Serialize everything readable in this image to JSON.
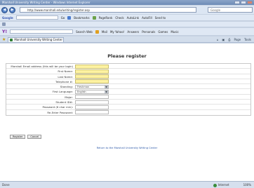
{
  "window": {
    "title": "Marshall University Writing Center - Windows Internet Explorer"
  },
  "address_bar": {
    "url": "http://www.marshall.edu/writing/register.asp",
    "search_placeholder": "Google"
  },
  "google_toolbar": {
    "label": "Google",
    "go": "Go",
    "items": [
      "Bookmarks",
      "PageRank",
      "Check",
      "AutoLink",
      "AutoFill",
      "Send to"
    ]
  },
  "yahoo_toolbar": {
    "label": "Y!",
    "search_web": "Search Web",
    "items": [
      "Mail",
      "My Yahoo!",
      "Answers",
      "Personals",
      "Games",
      "Music"
    ]
  },
  "tab": {
    "label": "Marshall University Writing Center"
  },
  "tab_tools": {
    "home": "⌂",
    "feeds": "▣",
    "print": "⎙",
    "page": "Page",
    "tools": "Tools"
  },
  "page": {
    "title": "Please register",
    "fields": [
      {
        "label": "Marshall Email address (this will be your login)",
        "kind": "input",
        "highlight": true,
        "value": ""
      },
      {
        "label": "First Name:",
        "kind": "input",
        "highlight": true,
        "value": ""
      },
      {
        "label": "Last Name:",
        "kind": "input",
        "highlight": true,
        "value": ""
      },
      {
        "label": "Telephone #:",
        "kind": "input",
        "highlight": true,
        "value": ""
      },
      {
        "label": "Standing:",
        "kind": "select",
        "value": "Freshman"
      },
      {
        "label": "First Language:",
        "kind": "select",
        "value": "English"
      },
      {
        "label": "Major:",
        "kind": "input",
        "highlight": false,
        "value": ""
      },
      {
        "label": "Student ID#:",
        "kind": "input",
        "highlight": false,
        "value": ""
      },
      {
        "label": "Password (6 char min):",
        "kind": "input",
        "highlight": false,
        "value": ""
      },
      {
        "label": "Re-Enter Password:",
        "kind": "input",
        "highlight": false,
        "value": ""
      }
    ],
    "buttons": {
      "register": "Register",
      "cancel": "Cancel"
    },
    "return_link": "Return to the Marshall University Writing Center"
  },
  "status_bar": {
    "left": "Done",
    "zone": "Internet",
    "zoom": "100%"
  }
}
